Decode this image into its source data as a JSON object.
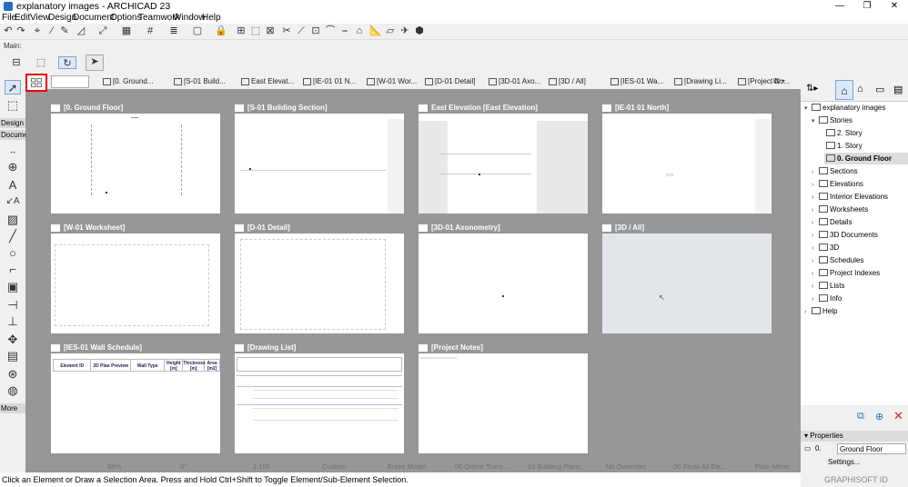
{
  "window": {
    "title": "explanatory images - ARCHICAD 23"
  },
  "menu": [
    "File",
    "Edit",
    "View",
    "Design",
    "Document",
    "Options",
    "Teamwork",
    "Window",
    "Help"
  ],
  "toolbar": {
    "main_label": "Main:"
  },
  "tabs": [
    {
      "label": "[0. Ground..."
    },
    {
      "label": "[S-01 Build..."
    },
    {
      "label": "East Elevat..."
    },
    {
      "label": "[IE-01 01 N..."
    },
    {
      "label": "[W-01 Wor..."
    },
    {
      "label": "[D-01 Detail]"
    },
    {
      "label": "[3D-01 Axo..."
    },
    {
      "label": "[3D / All]"
    },
    {
      "label": "[IES-01 Wa..."
    },
    {
      "label": "[Drawing Li..."
    },
    {
      "label": "[Project No..."
    }
  ],
  "toolbox": {
    "design_label": "Design",
    "document_label": "Documen",
    "more_label": "More"
  },
  "views": [
    {
      "title": "[0. Ground Floor]"
    },
    {
      "title": "[S-01 Building Section]"
    },
    {
      "title": "East Elevation [East Elevation]"
    },
    {
      "title": "[IE-01 01 North]"
    },
    {
      "title": "[W-01 Worksheet]"
    },
    {
      "title": "[D-01 Detail]"
    },
    {
      "title": "[3D-01 Axonometry]"
    },
    {
      "title": "[3D / All]"
    },
    {
      "title": "[IES-01 Wall Schedule]"
    },
    {
      "title": "[Drawing List]"
    },
    {
      "title": "[Project Notes]"
    }
  ],
  "schedule": {
    "headers": [
      "Element ID",
      "2D Plan Preview",
      "Wall Type",
      "Height [m]",
      "Thickness [m]",
      "Area [m2]"
    ]
  },
  "navigator": {
    "root": "explanatory images",
    "stories_label": "Stories",
    "stories": [
      "2. Story",
      "1. Story",
      "0. Ground Floor"
    ],
    "items": [
      "Sections",
      "Elevations",
      "Interior Elevations",
      "Worksheets",
      "Details",
      "3D Documents",
      "3D",
      "Schedules",
      "Project Indexes",
      "Lists",
      "Info"
    ],
    "help": "Help"
  },
  "properties": {
    "label": "Properties",
    "id": "0.",
    "name": "Ground Floor",
    "settings": "Settings...",
    "brand": "GRAPHISOFT ID"
  },
  "bottom": {
    "zoom": "68%",
    "angle": "0°",
    "scale": "1:100",
    "layer": "Custom",
    "model": "Entire Model",
    "pen": "00 Online Trans...",
    "plan": "03 Building Plans",
    "override": "No Overrides",
    "renovation": "00 Show All Ele...",
    "display": "Plain Meter"
  },
  "status": "Click an Element or Draw a Selection Area. Press and Hold Ctrl+Shift to Toggle Element/Sub-Element Selection."
}
